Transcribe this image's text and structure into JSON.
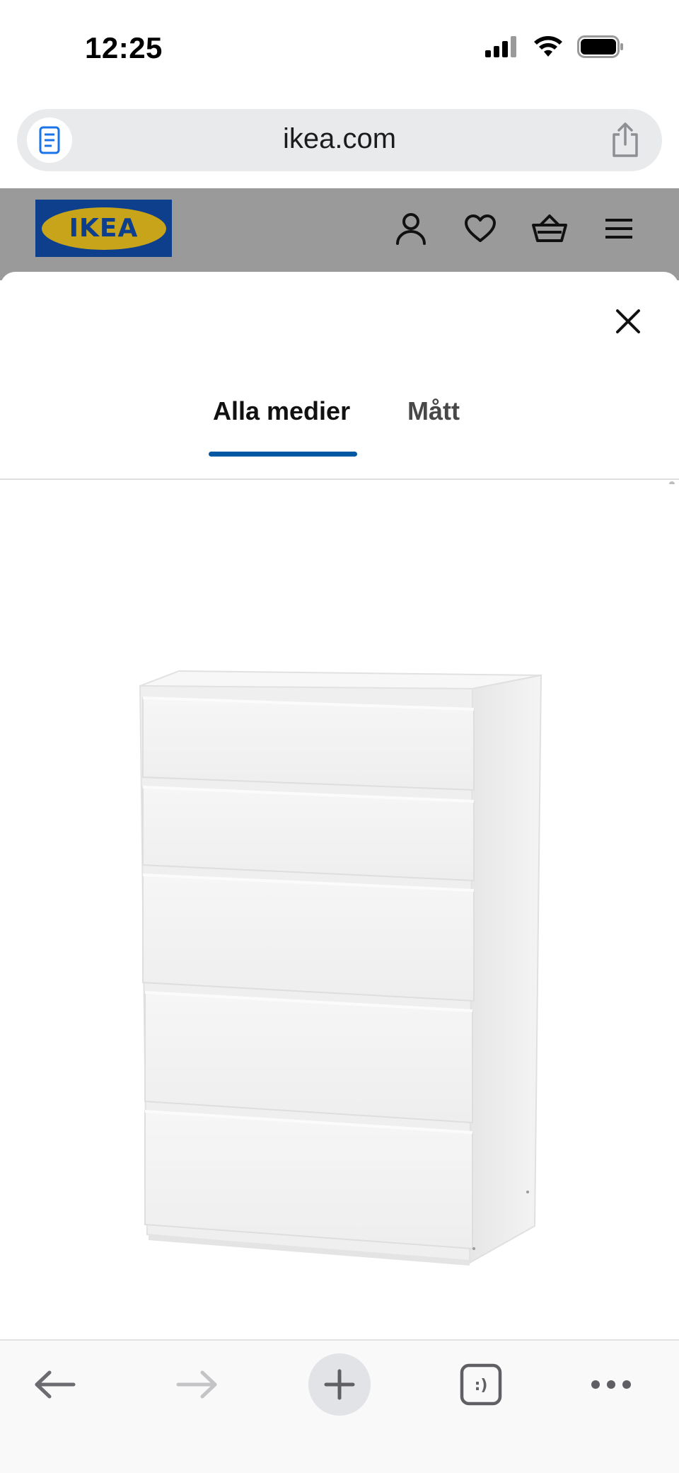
{
  "status_bar": {
    "time": "12:25"
  },
  "browser": {
    "url": "ikea.com",
    "tab_count_label": ":)"
  },
  "site_header": {
    "logo_text": "IKEA",
    "icons": [
      "account-icon",
      "wishlist-heart-icon",
      "shopping-basket-icon",
      "hamburger-menu-icon"
    ]
  },
  "modal": {
    "tabs": [
      {
        "label": "Alla medier",
        "selected": true
      },
      {
        "label": "Mått",
        "selected": false
      }
    ]
  },
  "colors": {
    "ikea_blue": "#0058a3",
    "logo_blue": "#0d3f8c",
    "logo_yellow": "#c7a41a",
    "dim_overlay": "#9a9a9a"
  }
}
